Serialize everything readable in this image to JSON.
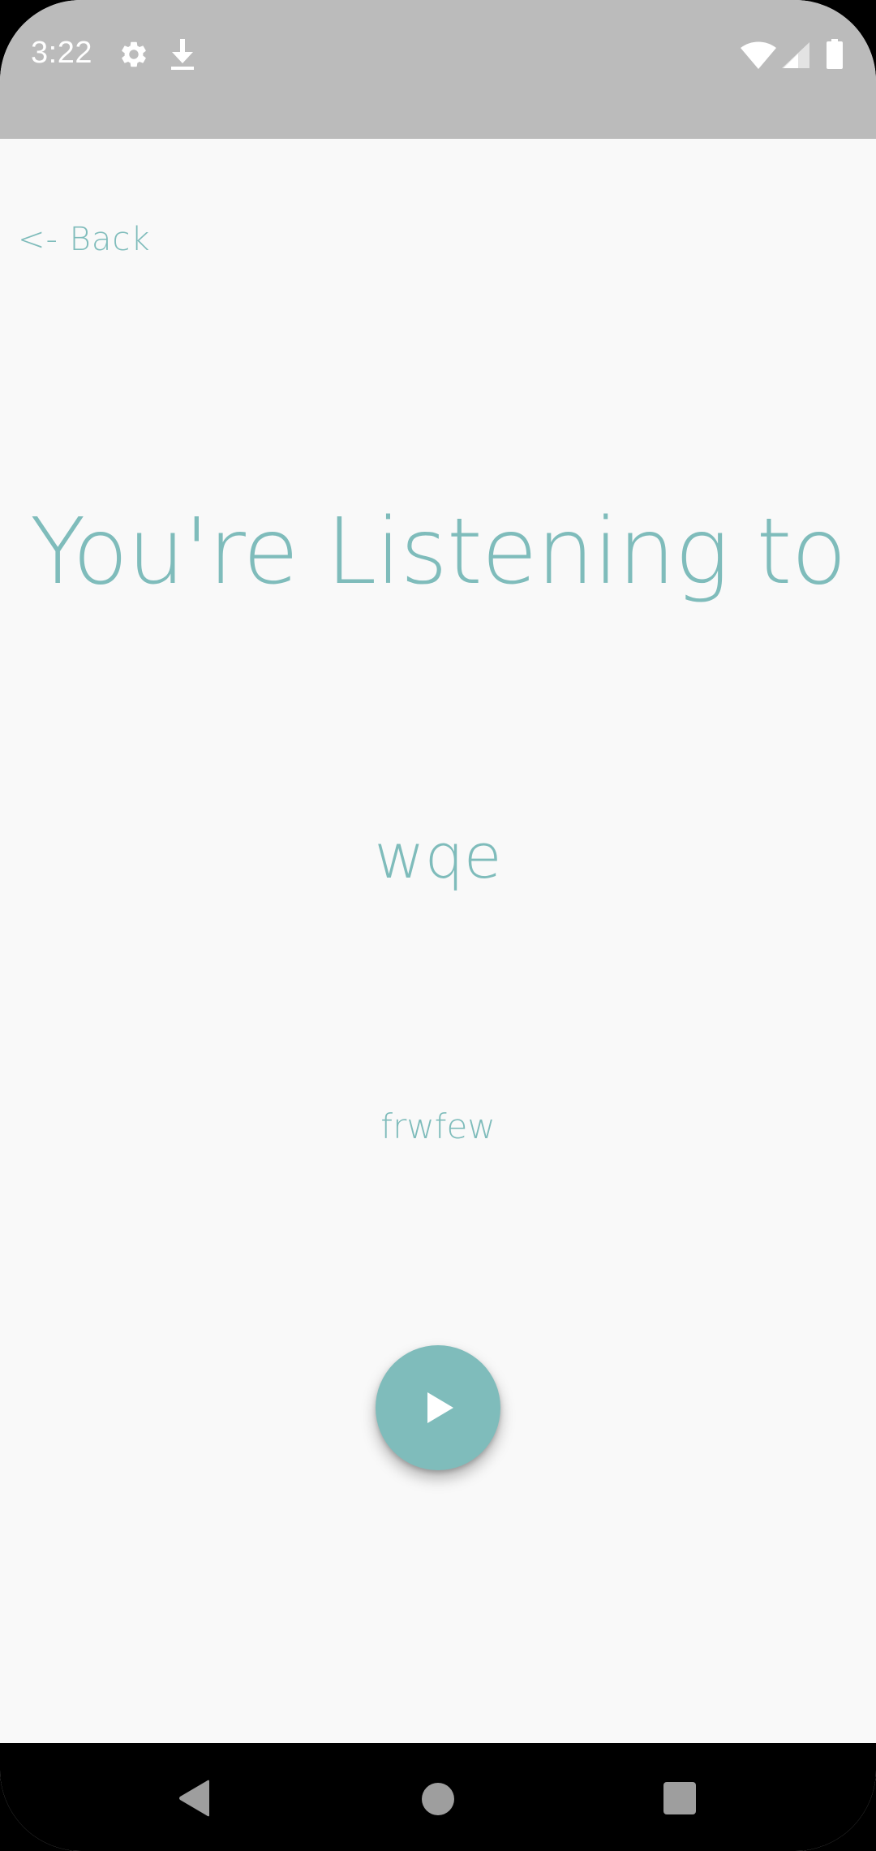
{
  "status_bar": {
    "time": "3:22",
    "background": "#bbbbbb",
    "icons": [
      "settings-icon",
      "download-icon",
      "wifi-icon",
      "cellular-signal-icon",
      "battery-icon"
    ]
  },
  "screen": {
    "back_label": "<- Back",
    "title": "You're Listening to",
    "track_name": "wqe",
    "artist_name": "frwfew",
    "accent_color": "#7fbcbb",
    "background": "#f9f9f9"
  },
  "play_button": {
    "icon": "play-icon"
  },
  "nav_bar": {
    "buttons": [
      "back-triangle-icon",
      "home-circle-icon",
      "recents-square-icon"
    ]
  }
}
